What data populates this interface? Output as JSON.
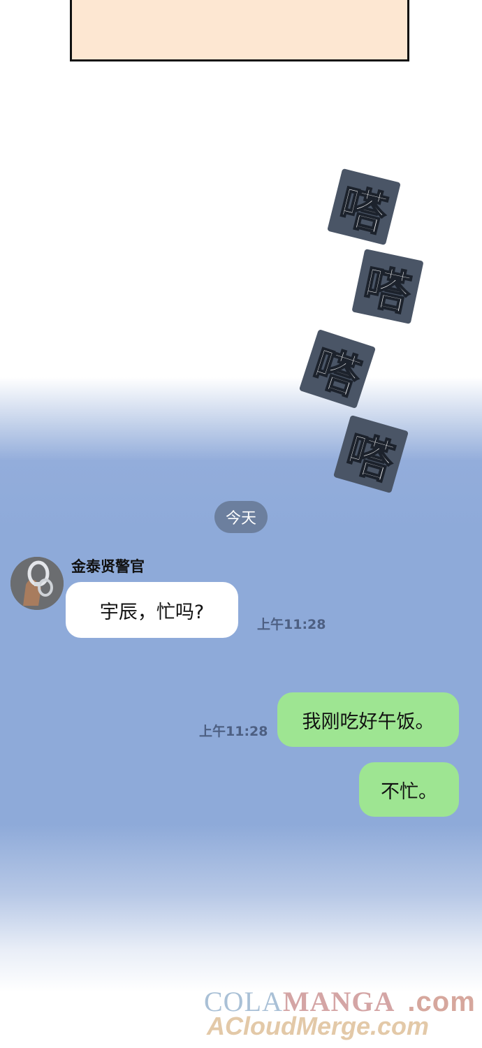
{
  "sfx": [
    "嗒",
    "嗒",
    "嗒",
    "嗒"
  ],
  "chat": {
    "date_label": "今天",
    "sender_name": "金泰贤警官",
    "incoming": {
      "text": "宇辰，忙吗?",
      "time": "上午11:28"
    },
    "outgoing": [
      {
        "text": "我刚吃好午饭。",
        "time": "上午11:28"
      },
      {
        "text": "不忙。",
        "time": ""
      }
    ]
  },
  "watermark": {
    "line1_a": "COLA",
    "line1_b": "MANGA",
    "line1_c": ".com",
    "line2": "ACloudMerge.com"
  },
  "colors": {
    "sfx_box": "#4a5566",
    "bg_blue": "#8eaad9",
    "outgoing_bubble": "#9ee592",
    "incoming_bubble": "#ffffff",
    "panel_fill": "#fde7d2"
  }
}
